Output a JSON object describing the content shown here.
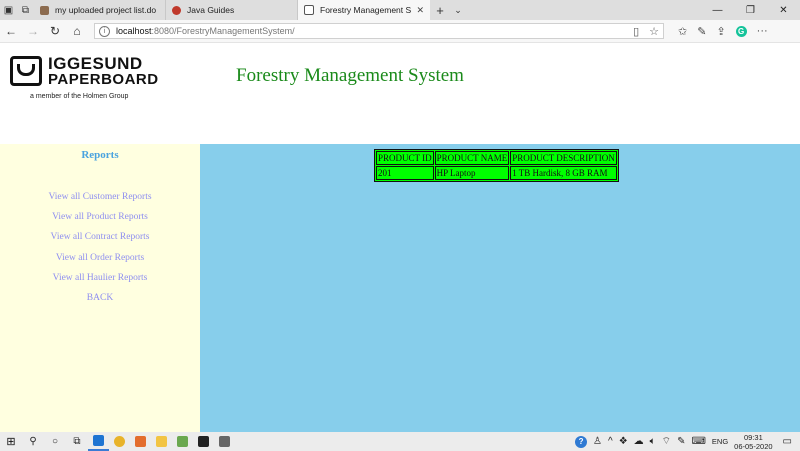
{
  "browser": {
    "tabs": [
      {
        "title": "my uploaded project list.do",
        "favicon_color": "#8c6b4f",
        "active": false
      },
      {
        "title": "Java Guides",
        "favicon_color": "#c0392b",
        "active": false
      },
      {
        "title": "Forestry Management S",
        "favicon_color": "#555555",
        "active": true
      }
    ],
    "url_host": "localhost",
    "url_path": ":8080/ForestryManagementSystem/"
  },
  "header": {
    "logo_line1": "IGGESUND",
    "logo_line2": "PAPERBOARD",
    "logo_subtitle": "a member of the Holmen Group",
    "title": "Forestry Management System"
  },
  "sidebar": {
    "title": "Reports",
    "links": [
      "View all Customer Reports",
      "View all Product Reports",
      "View all Contract Reports",
      "View all Order Reports",
      "View all Haulier Reports",
      "BACK"
    ]
  },
  "table": {
    "columns": [
      "PRODUCT ID",
      "PRODUCT NAME",
      "PRODUCT DESCRIPTION"
    ],
    "rows": [
      [
        "201",
        "HP Laptop",
        "1 TB Hardisk, 8 GB RAM"
      ]
    ]
  },
  "taskbar": {
    "language": "ENG",
    "time": "09:31",
    "date": "06-05-2020"
  },
  "colors": {
    "title_green": "#1a8a1a",
    "sidebar_bg": "#ffffe0",
    "content_bg": "#87ceeb",
    "table_bg": "#00ff00",
    "link": "#8e8ef0"
  }
}
